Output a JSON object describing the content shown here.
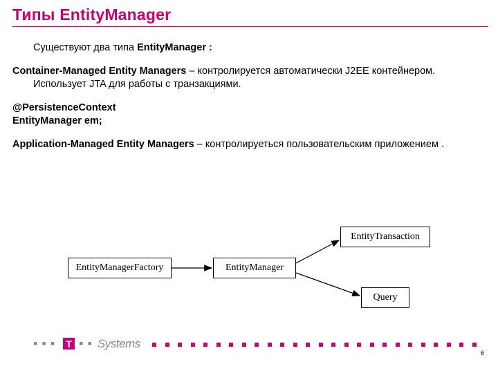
{
  "title": "Типы EntityManager",
  "intro_prefix": "Существуют два типа ",
  "intro_bold": "EntityManager :",
  "p1_bold": "Container-Managed Entity Managers",
  "p1_rest": " – контролируется автоматически J2EE контейнером. Использует JTA для работы с транзакциями.",
  "p2_line1": "@PersistenceContext",
  "p2_line2": "EntityManager em;",
  "p3_bold": "Application-Managed Entity Managers",
  "p3_rest": " – контролируеться пользовательским приложением .",
  "diagram": {
    "emf": "EntityManagerFactory",
    "em": "EntityManager",
    "et": "EntityTransaction",
    "q": "Query"
  },
  "logo": {
    "letter": "T",
    "word": "Systems"
  },
  "page": "6",
  "colors": {
    "accent": "#c5007b",
    "grey": "#888888"
  }
}
